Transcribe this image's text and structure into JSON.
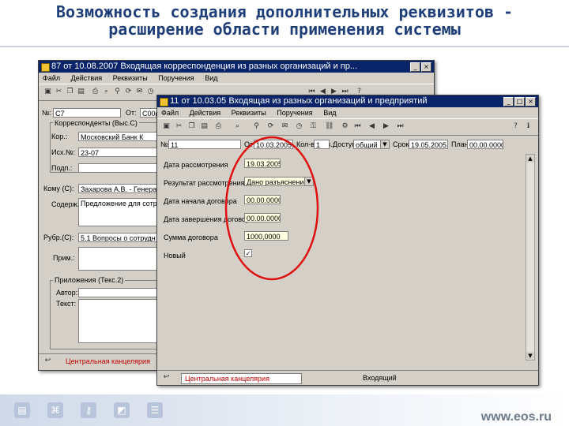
{
  "slide": {
    "title_line1": "Возможность создания дополнительных реквизитов -",
    "title_line2": "расширение области применения системы",
    "footer_url": "www.eos.ru"
  },
  "back_window": {
    "title": "87 от 10.08.2007 Входящая корреспонденция из разных организаций и пр...",
    "menu": [
      "Файл",
      "Действия",
      "Реквизиты",
      "Поручения",
      "Вид"
    ],
    "fields": {
      "number_label": "№:",
      "number_value": "С7",
      "from_label": "От:",
      "from_value": "С00(",
      "correspondents_group": "Корреспонденты (Выс.С)",
      "org_label": "Кор.:",
      "org_value": "Московский Банк К",
      "ishod_label": "Исх.№:",
      "ishod_value": "23-07",
      "signed_label": "Подп.:",
      "addressee_label": "Кому (С):",
      "addressee_value": "Захарова А.В. - Генерал",
      "content_label": "Содерж.:",
      "content_value": "Предложение для сотру",
      "rubric_label": "Рубр.(С):",
      "rubric_value": "5.1 Вопросы о сотрудн",
      "note_label": "Прим.:",
      "files_group": "Приложения (Текс.2)",
      "author_label": "Автор:",
      "text_label": "Текст:",
      "status_text": "Центральная канцелярия"
    }
  },
  "front_window": {
    "title": "11 от 10.03.05 Входящая из разных организаций и предприятий",
    "menu": [
      "Файл",
      "Действия",
      "Реквизиты",
      "Поручения",
      "Вид"
    ],
    "top": {
      "number_label": "№:",
      "number_value": "11",
      "from_label": "От:",
      "from_value": "10.03.2005",
      "copies_label": "Кол-во экз.:",
      "copies_value": "1",
      "access_label": "Доступ:",
      "access_value": "общий",
      "term_label": "Срок:",
      "term_value": "19.05.2005",
      "plan_label": "План:",
      "plan_value": "00.00.0000"
    },
    "custom_fields": [
      {
        "label": "Дата рассмотрения",
        "value": "19.03.2005",
        "kind": "text"
      },
      {
        "label": "Результат рассмотрения",
        "value": "Дано разъяснение",
        "kind": "select"
      },
      {
        "label": "Дата начала договора",
        "value": "00.00.0000",
        "kind": "text"
      },
      {
        "label": "Дата завершения договора",
        "value": "00.00.0000",
        "kind": "text"
      },
      {
        "label": "Сумма договора",
        "value": "1000,0000",
        "kind": "text"
      },
      {
        "label": "Новый",
        "value": "✓",
        "kind": "checkbox"
      }
    ],
    "status_text": "Центральная канцелярия",
    "status_right": "Входящий"
  },
  "colors": {
    "title": "#1f3f7a",
    "window_titlebar": "#0a246a",
    "highlight_ellipse": "#e01010"
  }
}
